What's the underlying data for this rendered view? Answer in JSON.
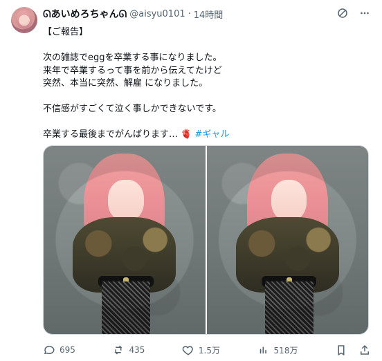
{
  "tweet": {
    "user": {
      "display_name": "ᘏあいめろちゃんᘏ",
      "handle": "@aisyu0101",
      "time": "14時間"
    },
    "text_lines": [
      "【ご報告】",
      "",
      "次の雑誌でeggを卒業する事になりました。",
      "来年で卒業するって事を前から伝えてたけど",
      "突然、本当に突然、解雇 になりました。",
      "",
      "不信感がすごくて泣く事しかできないです。",
      "",
      "卒業する最後までがんばります…"
    ],
    "heart_emoji": "🫀",
    "hashtag": "#ギャル",
    "stats": {
      "replies": "695",
      "retweets": "435",
      "likes": "1.5万",
      "views": "518万"
    },
    "icons": {
      "grok": "grok-icon",
      "more": "more-icon",
      "reply": "reply-icon",
      "retweet": "retweet-icon",
      "like": "like-icon",
      "views": "views-icon",
      "bookmark": "bookmark-icon",
      "share": "share-icon"
    }
  }
}
